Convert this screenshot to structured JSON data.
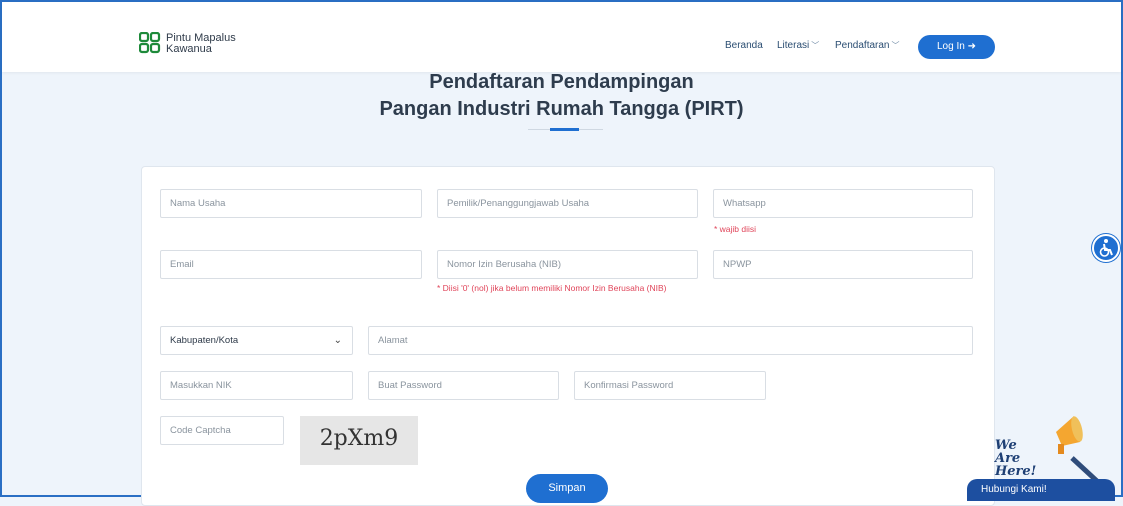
{
  "header": {
    "brand_line1": "Pintu Mapalus",
    "brand_line2": "Kawanua",
    "nav": [
      "Beranda",
      "Literasi",
      "Pendaftaran"
    ],
    "login_label": "Log In",
    "login_icon": "sign-in-icon"
  },
  "page": {
    "title_line1": "Pendaftaran Pendampingan",
    "title_line2": "Pangan Industri Rumah Tangga (PIRT)"
  },
  "form": {
    "nama_usaha": "Nama Usaha",
    "pemilik": "Pemilik/Penanggungjawab Usaha",
    "whatsapp": "Whatsapp",
    "whatsapp_hint": "* wajib diisi",
    "email": "Email",
    "nib": "Nomor Izin Berusaha (NIB)",
    "nib_hint": "* Diisi '0' (nol) jika belum memiliki Nomor Izin Berusaha (NIB)",
    "npwp": "NPWP",
    "kabupaten_selected": "Kabupaten/Kota",
    "alamat": "Alamat",
    "nik": "Masukkan NIK",
    "password": "Buat Password",
    "confirm_password": "Konfirmasi Password",
    "captcha_placeholder": "Code Captcha",
    "captcha_text": "2pXm9",
    "submit_label": "Simpan"
  },
  "widget": {
    "we_are_here": "We Are Here!",
    "contact_label": "Hubungi Kami!"
  },
  "colors": {
    "accent": "#1f6fd1",
    "error": "#e0455a",
    "brand_green": "#1e8a3a"
  }
}
